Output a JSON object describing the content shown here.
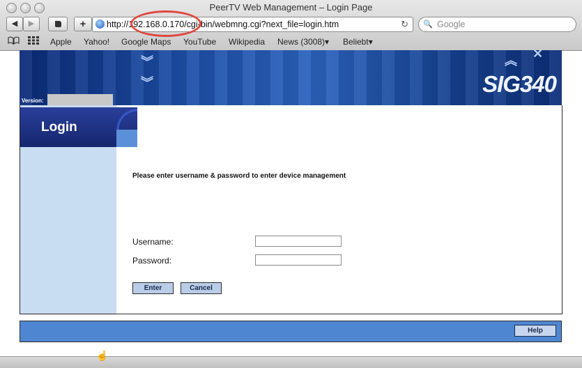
{
  "window": {
    "title": "PeerTV Web Management – Login Page"
  },
  "toolbar": {
    "back_icon": "◀",
    "forward_icon": "▶",
    "add_icon": "+",
    "url": "http://192.168.0.170/cgi-bin/webmng.cgi?next_file=login.htm",
    "reload_icon": "↻",
    "search_placeholder": "Google"
  },
  "bookmarks": {
    "items": [
      "Apple",
      "Yahoo!",
      "Google Maps",
      "YouTube",
      "Wikipedia",
      "News (3008)▾",
      "Beliebt▾"
    ]
  },
  "page": {
    "banner_model": "SIG340",
    "version_label": "Version:",
    "version_value": "",
    "login_title": "Login",
    "instructions": "Please enter username & password to enter device management",
    "username_label": "Username:",
    "password_label": "Password:",
    "username_value": "",
    "password_value": "",
    "enter_label": "Enter",
    "cancel_label": "Cancel",
    "help_label": "Help"
  },
  "colors": {
    "annotation_circle": "#e0463d",
    "banner_blue": "#1d4fa8",
    "sidebar_blue": "#c8dcf2",
    "footer_blue": "#4f86d2"
  }
}
